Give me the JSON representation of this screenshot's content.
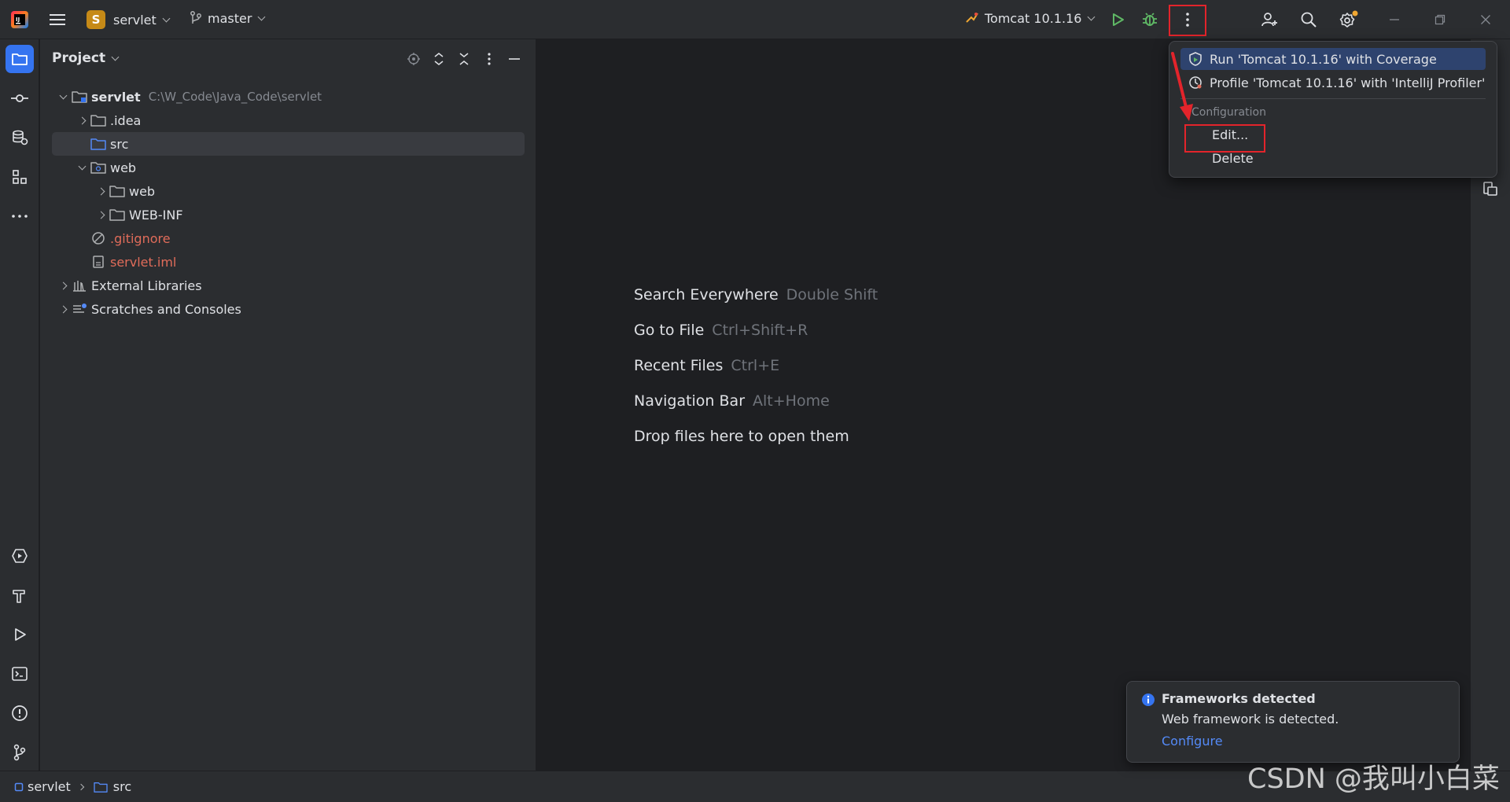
{
  "titlebar": {
    "project_badge": "S",
    "project_name": "servlet",
    "branch": "master",
    "run_config": "Tomcat 10.1.16"
  },
  "project_panel": {
    "title": "Project",
    "tree": [
      {
        "label": "servlet",
        "hint": "C:\\W_Code\\Java_Code\\servlet"
      },
      {
        "label": ".idea"
      },
      {
        "label": "src"
      },
      {
        "label": "web"
      },
      {
        "label": "web"
      },
      {
        "label": "WEB-INF"
      },
      {
        "label": ".gitignore"
      },
      {
        "label": "servlet.iml"
      },
      {
        "label": "External Libraries"
      },
      {
        "label": "Scratches and Consoles"
      }
    ]
  },
  "editor_hints": [
    {
      "action": "Search Everywhere",
      "shortcut": "Double Shift"
    },
    {
      "action": "Go to File",
      "shortcut": "Ctrl+Shift+R"
    },
    {
      "action": "Recent Files",
      "shortcut": "Ctrl+E"
    },
    {
      "action": "Navigation Bar",
      "shortcut": "Alt+Home"
    },
    {
      "action": "Drop files here to open them",
      "shortcut": ""
    }
  ],
  "popup": {
    "run_coverage": "Run 'Tomcat 10.1.16' with Coverage",
    "profile": "Profile 'Tomcat 10.1.16' with 'IntelliJ Profiler'",
    "section_label": "Configuration",
    "edit": "Edit...",
    "delete": "Delete"
  },
  "notification": {
    "title": "Frameworks detected",
    "body": "Web framework is detected.",
    "link": "Configure"
  },
  "statusbar": {
    "crumbs": [
      "servlet",
      "src"
    ]
  },
  "watermark": "CSDN @我叫小白菜",
  "colors": {
    "accent": "#3574f0",
    "highlight_red": "#e3242b",
    "run_green": "#5fb865",
    "ignored_file": "#e06c5a",
    "link": "#548af7"
  }
}
